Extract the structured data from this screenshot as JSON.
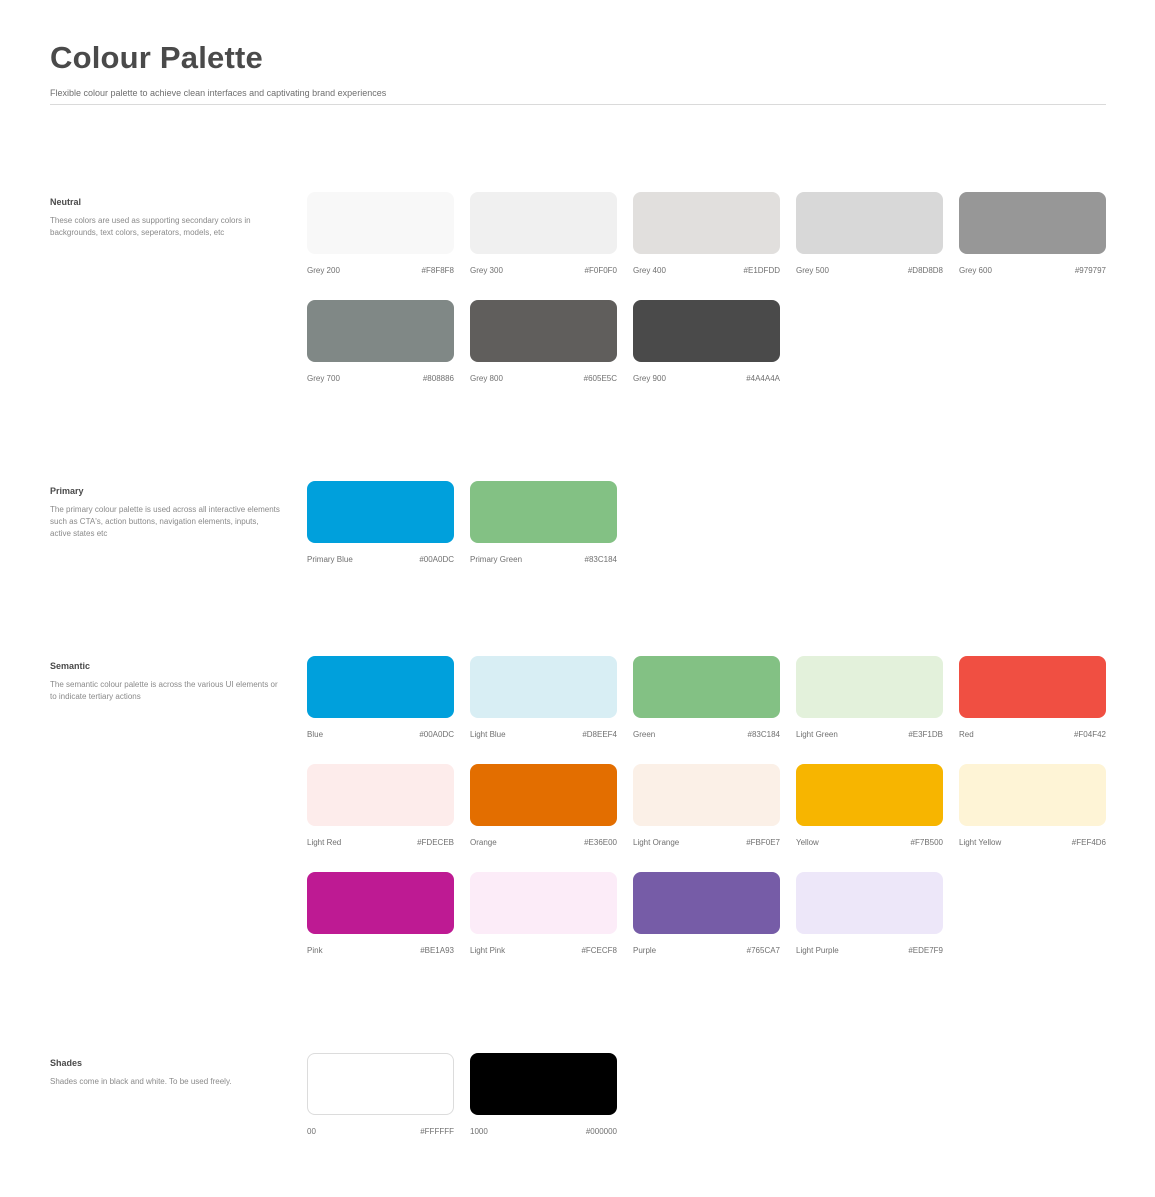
{
  "page": {
    "title": "Colour Palette",
    "subtitle": "Flexible colour palette to achieve clean interfaces and captivating brand experiences"
  },
  "sections": [
    {
      "title": "Neutral",
      "description": "These colors are used as supporting secondary colors in backgrounds, text colors, seperators, models, etc",
      "swatches": [
        {
          "name": "Grey 200",
          "hex": "#F8F8F8"
        },
        {
          "name": "Grey 300",
          "hex": "#F0F0F0"
        },
        {
          "name": "Grey 400",
          "hex": "#E1DFDD"
        },
        {
          "name": "Grey 500",
          "hex": "#D8D8D8"
        },
        {
          "name": "Grey 600",
          "hex": "#979797"
        },
        {
          "name": "Grey 700",
          "hex": "#808886"
        },
        {
          "name": "Grey 800",
          "hex": "#605E5C"
        },
        {
          "name": "Grey 900",
          "hex": "#4A4A4A"
        }
      ]
    },
    {
      "title": "Primary",
      "description": "The primary colour palette is used across all interactive elements such as CTA's, action buttons, navigation elements, inputs, active states etc",
      "swatches": [
        {
          "name": "Primary Blue",
          "hex": "#00A0DC"
        },
        {
          "name": "Primary Green",
          "hex": "#83C184"
        }
      ]
    },
    {
      "title": "Semantic",
      "description": "The semantic colour palette is across the various UI elements or to indicate tertiary actions",
      "swatches": [
        {
          "name": "Blue",
          "hex": "#00A0DC"
        },
        {
          "name": "Light Blue",
          "hex": "#D8EEF4"
        },
        {
          "name": "Green",
          "hex": "#83C184"
        },
        {
          "name": "Light Green",
          "hex": "#E3F1DB"
        },
        {
          "name": "Red",
          "hex": "#F04F42"
        },
        {
          "name": "Light Red",
          "hex": "#FDECEB"
        },
        {
          "name": "Orange",
          "hex": "#E36E00"
        },
        {
          "name": "Light Orange",
          "hex": "#FBF0E7"
        },
        {
          "name": "Yellow",
          "hex": "#F7B500"
        },
        {
          "name": "Light Yellow",
          "hex": "#FEF4D6"
        },
        {
          "name": "Pink",
          "hex": "#BE1A93"
        },
        {
          "name": "Light Pink",
          "hex": "#FCECF8"
        },
        {
          "name": "Purple",
          "hex": "#765CA7"
        },
        {
          "name": "Light Purple",
          "hex": "#EDE7F9"
        }
      ]
    },
    {
      "title": "Shades",
      "description": "Shades come in black and white. To be used freely.",
      "swatches": [
        {
          "name": "00",
          "hex": "#FFFFFF"
        },
        {
          "name": "1000",
          "hex": "#000000"
        }
      ]
    }
  ]
}
